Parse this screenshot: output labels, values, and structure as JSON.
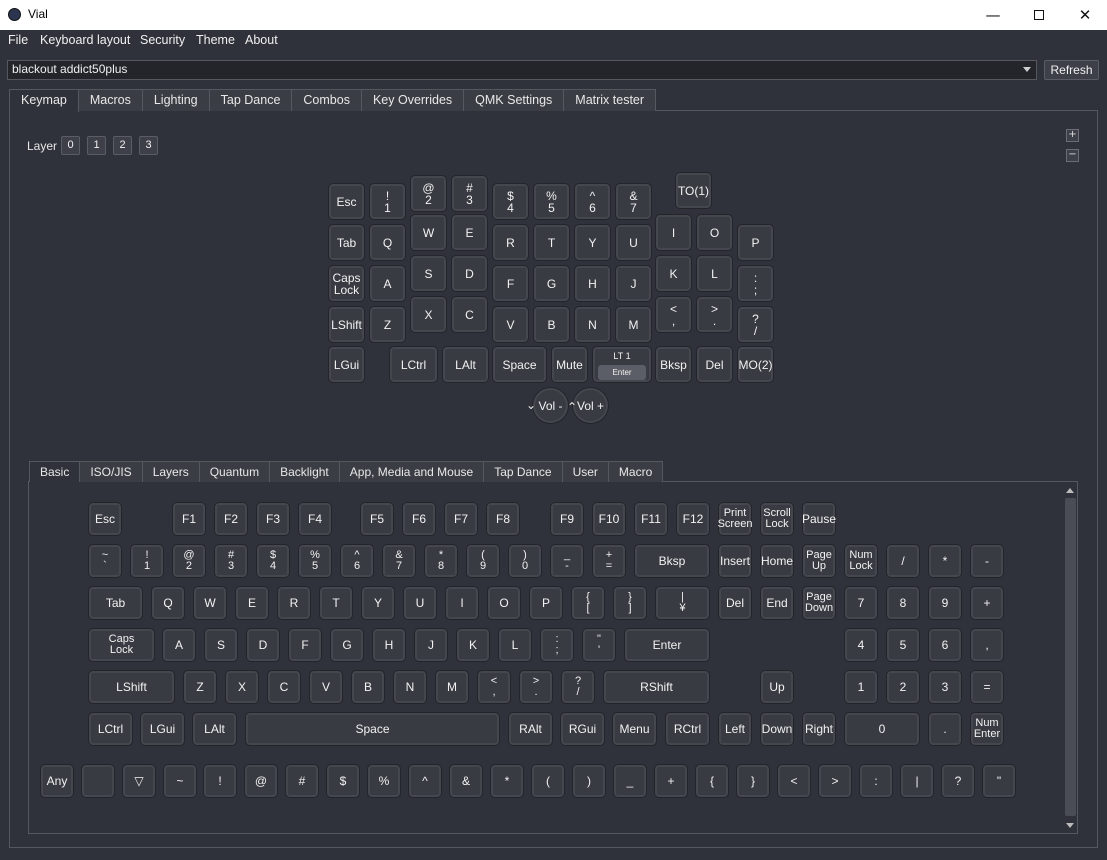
{
  "window": {
    "title": "Vial"
  },
  "menu": [
    "File",
    "Keyboard layout",
    "Security",
    "Theme",
    "About"
  ],
  "device": {
    "selected": "blackout addict50plus",
    "refresh_label": "Refresh"
  },
  "main_tabs": [
    "Keymap",
    "Macros",
    "Lighting",
    "Tap Dance",
    "Combos",
    "Key Overrides",
    "QMK Settings",
    "Matrix tester"
  ],
  "layers": {
    "label": "Layer",
    "buttons": [
      "0",
      "1",
      "2",
      "3"
    ]
  },
  "zoom": {
    "plus": "+",
    "minus": "−"
  },
  "keyboard_keys": [
    {
      "l": "Esc"
    },
    {
      "l": "!\n1"
    },
    {
      "l": "@\n2"
    },
    {
      "l": "#\n3"
    },
    {
      "l": "$\n4"
    },
    {
      "l": "%\n5"
    },
    {
      "l": "^\n6"
    },
    {
      "l": "&\n7"
    },
    {
      "l": "TO(1)"
    },
    {
      "l": "Tab"
    },
    {
      "l": "Q"
    },
    {
      "l": "W"
    },
    {
      "l": "E"
    },
    {
      "l": "R"
    },
    {
      "l": "T"
    },
    {
      "l": "Y"
    },
    {
      "l": "U"
    },
    {
      "l": "I"
    },
    {
      "l": "O"
    },
    {
      "l": "P"
    },
    {
      "l": "Caps\nLock"
    },
    {
      "l": "A"
    },
    {
      "l": "S"
    },
    {
      "l": "D"
    },
    {
      "l": "F"
    },
    {
      "l": "G"
    },
    {
      "l": "H"
    },
    {
      "l": "J"
    },
    {
      "l": "K"
    },
    {
      "l": "L"
    },
    {
      "l": ":\n;"
    },
    {
      "l": "LShift"
    },
    {
      "l": "Z"
    },
    {
      "l": "X"
    },
    {
      "l": "C"
    },
    {
      "l": "V"
    },
    {
      "l": "B"
    },
    {
      "l": "N"
    },
    {
      "l": "M"
    },
    {
      "l": "<\n,"
    },
    {
      "l": ">\n."
    },
    {
      "l": "?\n/"
    },
    {
      "l": "LGui"
    },
    {
      "l": "LCtrl"
    },
    {
      "l": "LAlt"
    },
    {
      "l": "Space"
    },
    {
      "l": "Mute"
    },
    {
      "l": "LT 1",
      "sub": "Enter"
    },
    {
      "l": "Bksp"
    },
    {
      "l": "Del"
    },
    {
      "l": "MO(2)"
    },
    {
      "l": "Vol -"
    },
    {
      "l": "Vol +"
    }
  ],
  "encoder_arrows": {
    "ccw": "⌄",
    "cw": "⌃"
  },
  "sub_tabs": [
    "Basic",
    "ISO/JIS",
    "Layers",
    "Quantum",
    "Backlight",
    "App, Media and Mouse",
    "Tap Dance",
    "User",
    "Macro"
  ],
  "palette_keys": [
    "Esc",
    "F1",
    "F2",
    "F3",
    "F4",
    "F5",
    "F6",
    "F7",
    "F8",
    "F9",
    "F10",
    "F11",
    "F12",
    "Print\nScreen",
    "Scroll\nLock",
    "Pause",
    "~\n`",
    "!\n1",
    "@\n2",
    "#\n3",
    "$\n4",
    "%\n5",
    "^\n6",
    "&\n7",
    "*\n8",
    "(\n9",
    ")\n0",
    "_\n-",
    "+\n=",
    "Bksp",
    "Insert",
    "Home",
    "Page\nUp",
    "Num\nLock",
    "/",
    "*",
    "-",
    "Tab",
    "Q",
    "W",
    "E",
    "R",
    "T",
    "Y",
    "U",
    "I",
    "O",
    "P",
    "{\n[",
    "}\n]",
    "|\n¥",
    "Del",
    "End",
    "Page\nDown",
    "7",
    "8",
    "9",
    "+",
    "Caps\nLock",
    "A",
    "S",
    "D",
    "F",
    "G",
    "H",
    "J",
    "K",
    "L",
    ":\n;",
    "\"\n'",
    "Enter",
    "4",
    "5",
    "6",
    ",",
    "LShift",
    "Z",
    "X",
    "C",
    "V",
    "B",
    "N",
    "M",
    "<\n,",
    ">\n.",
    "?\n/",
    "RShift",
    "Up",
    "1",
    "2",
    "3",
    "=",
    "LCtrl",
    "LGui",
    "LAlt",
    "Space",
    "RAlt",
    "RGui",
    "Menu",
    "RCtrl",
    "Left",
    "Down",
    "Right",
    "0",
    ".",
    "Num\nEnter",
    "Any",
    "",
    "▽",
    "~",
    "!",
    "@",
    "#",
    "$",
    "%",
    "^",
    "&",
    "*",
    "(",
    ")",
    "_",
    "+",
    "{",
    "}",
    "<",
    ">",
    ":",
    "|",
    "?",
    "\""
  ]
}
